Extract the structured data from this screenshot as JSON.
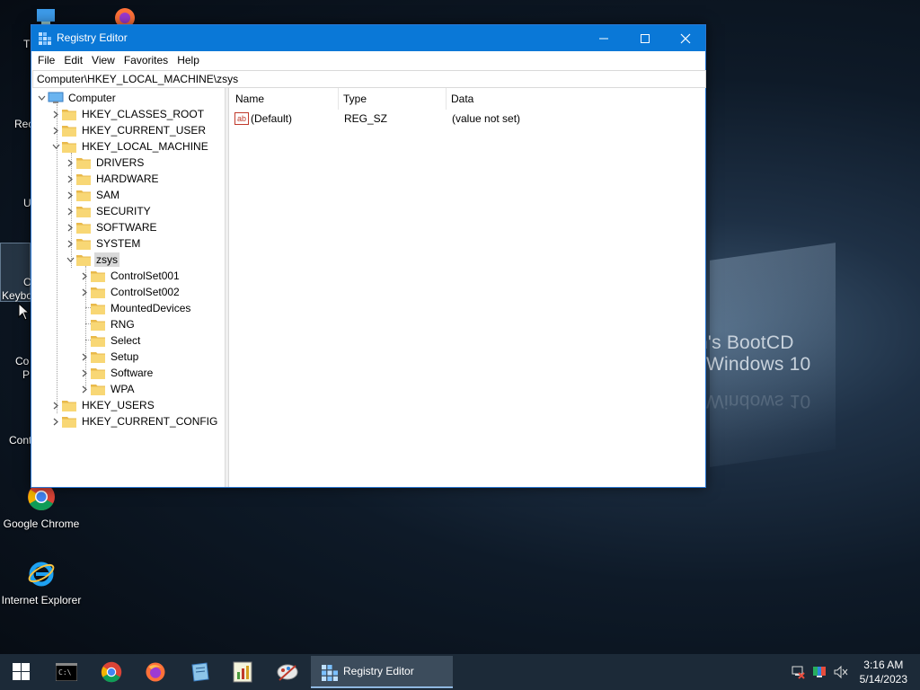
{
  "wallpaper": {
    "line1": "n's BootCD",
    "line2": "Windows 10",
    "line2_reflection": "Windows 10"
  },
  "desktop": {
    "icons": [
      {
        "label": "Google Chrome",
        "icon": "chrome-icon"
      },
      {
        "label": "Internet Explorer",
        "icon": "ie-icon"
      }
    ],
    "fragments": [
      "T",
      "Rec",
      "U",
      "C",
      "Keybo",
      "Co",
      "P",
      "Cont"
    ]
  },
  "window": {
    "title": "Registry Editor",
    "minimize_glyph": "—",
    "maximize_glyph": "☐",
    "close_glyph": "✕",
    "menu": [
      "File",
      "Edit",
      "View",
      "Favorites",
      "Help"
    ],
    "address": "Computer\\HKEY_LOCAL_MACHINE\\zsys",
    "tree": {
      "root": "Computer",
      "hives": [
        "HKEY_CLASSES_ROOT",
        "HKEY_CURRENT_USER",
        "HKEY_LOCAL_MACHINE"
      ],
      "hklm_children": [
        "DRIVERS",
        "HARDWARE",
        "SAM",
        "SECURITY",
        "SOFTWARE",
        "SYSTEM",
        "zsys"
      ],
      "zsys_children": [
        "ControlSet001",
        "ControlSet002",
        "MountedDevices",
        "RNG",
        "Select",
        "Setup",
        "Software",
        "WPA"
      ],
      "bottom_hives": [
        "HKEY_USERS",
        "HKEY_CURRENT_CONFIG"
      ]
    },
    "columns": [
      "Name",
      "Type",
      "Data"
    ],
    "values": [
      {
        "name": "(Default)",
        "type": "REG_SZ",
        "data": "(value not set)"
      }
    ],
    "value_icon_text": "ab"
  },
  "taskbar": {
    "active_task": "Registry Editor",
    "time": "3:16 AM",
    "date": "5/14/2023"
  },
  "colors": {
    "accent": "#0a78d7",
    "folder": "#f3d175",
    "taskbar": "#1c2a38"
  }
}
